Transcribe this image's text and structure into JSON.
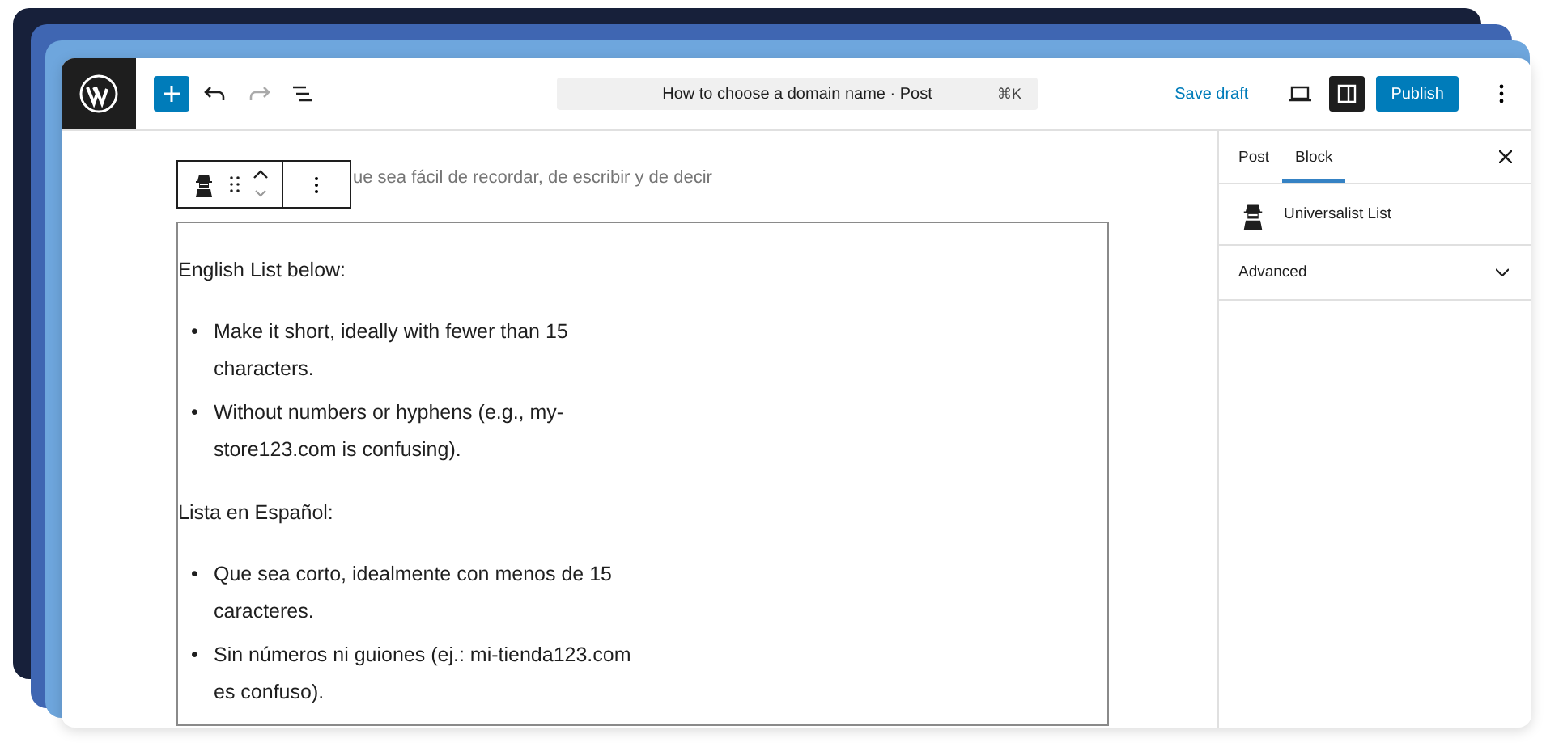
{
  "toolbar": {
    "title": "How to choose a domain name · Post",
    "shortcut": "⌘K",
    "save_label": "Save draft",
    "publish_label": "Publish",
    "sidebar_open": true
  },
  "editor": {
    "partial_text": "ue sea fácil de recordar, de escribir y de decir",
    "sections": [
      {
        "heading": "English List below:",
        "items": [
          {
            "bullet": "•",
            "text": "Make it short, ideally with fewer than 15 characters."
          },
          {
            "bullet": "•",
            "text": "Without numbers or hyphens (e.g., my-store123.com is confusing)."
          }
        ]
      },
      {
        "heading": "Lista en Español:",
        "items": [
          {
            "bullet": "•",
            "text": "Que sea corto, idealmente con menos de 15 caracteres."
          },
          {
            "bullet": "•",
            "text": "Sin números ni guiones (ej.: mi-tienda123.com es confuso)."
          }
        ]
      }
    ]
  },
  "sidebar": {
    "tabs": [
      {
        "label": "Post",
        "selected": false
      },
      {
        "label": "Block",
        "selected": true
      }
    ],
    "block_name": "Universalist List",
    "panels": [
      {
        "label": "Advanced",
        "expanded": false
      }
    ]
  }
}
